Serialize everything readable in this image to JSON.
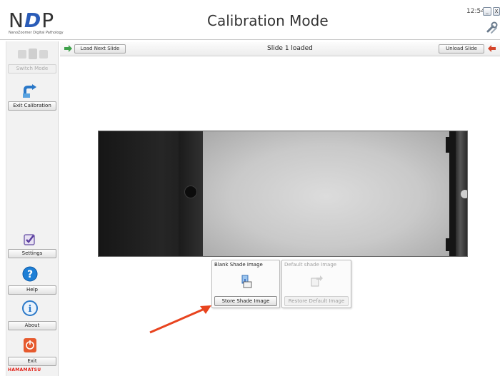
{
  "header": {
    "logo_text": "NDP",
    "logo_subtitle": "NanoZoomer Digital Pathology",
    "title": "Calibration Mode",
    "clock": "12:54",
    "minimize_icon": "minimize-icon",
    "close_label": "X"
  },
  "sidebar": {
    "switch_mode_label": "Switch Mode",
    "exit_calibration_label": "Exit Calibration",
    "settings_label": "Settings",
    "help_label": "Help",
    "about_label": "About",
    "exit_label": "Exit",
    "brand": "HAMAMATSU"
  },
  "toolbar": {
    "load_next_label": "Load Next Slide",
    "status": "Slide 1 loaded",
    "unload_label": "Unload Slide"
  },
  "shade": {
    "blank_title": "Blank Shade Image",
    "store_label": "Store Shade Image",
    "default_title": "Default shade Image",
    "restore_label": "Restore Default Image"
  },
  "colors": {
    "accent_blue": "#2a5cb8",
    "help_blue": "#1e7fd6",
    "exit_red": "#e65a2e",
    "arrow_red": "#e8441f",
    "brand_red": "#e2231a"
  }
}
